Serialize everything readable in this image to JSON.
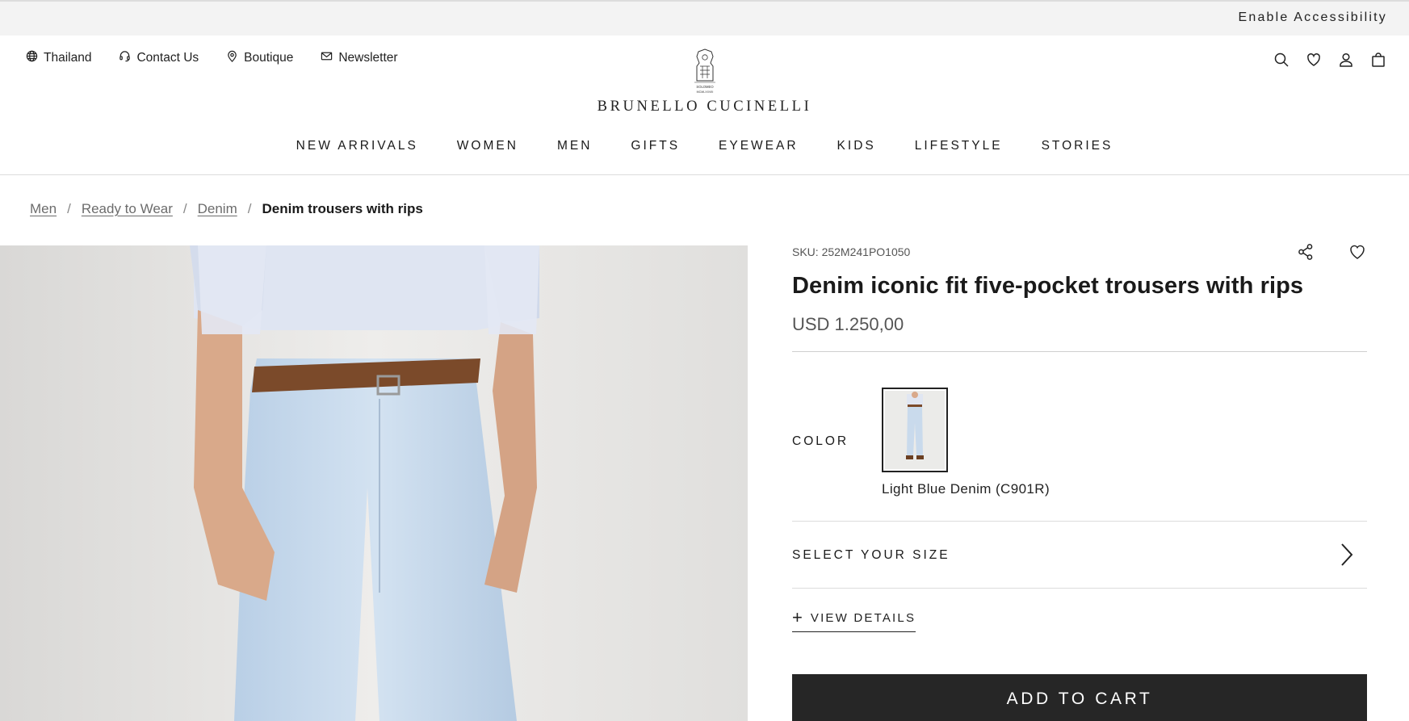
{
  "topbar": {
    "accessibility": "Enable Accessibility"
  },
  "utility": {
    "country": "Thailand",
    "contact": "Contact Us",
    "boutique": "Boutique",
    "newsletter": "Newsletter"
  },
  "brand": {
    "name": "BRUNELLO CUCINELLI"
  },
  "nav": [
    "NEW ARRIVALS",
    "WOMEN",
    "MEN",
    "GIFTS",
    "EYEWEAR",
    "KIDS",
    "LIFESTYLE",
    "STORIES"
  ],
  "breadcrumb": {
    "items": [
      "Men",
      "Ready to Wear",
      "Denim"
    ],
    "current": "Denim trousers with rips",
    "separator": "/"
  },
  "product": {
    "sku": "SKU: 252M241PO1050",
    "title": "Denim iconic fit five-pocket trousers with rips",
    "price": "USD 1.250,00",
    "color_label": "COLOR",
    "color_name": "Light Blue Denim (C901R)",
    "size_label": "SELECT YOUR SIZE",
    "details_label": "VIEW DETAILS",
    "add_to_cart": "ADD TO CART"
  },
  "icons": {
    "globe": "globe-icon",
    "headset": "headset-icon",
    "pin": "location-pin-icon",
    "mail": "envelope-icon",
    "search": "search-icon",
    "wishlist": "heart-icon",
    "account": "user-icon",
    "bag": "shopping-bag-icon",
    "share": "share-icon",
    "chevron": "chevron-right-icon",
    "plus": "plus-icon"
  },
  "colors": {
    "cart_button": "#262626",
    "denim": "#c9daec",
    "shirt": "#dde4f1",
    "belt": "#8a5530"
  }
}
